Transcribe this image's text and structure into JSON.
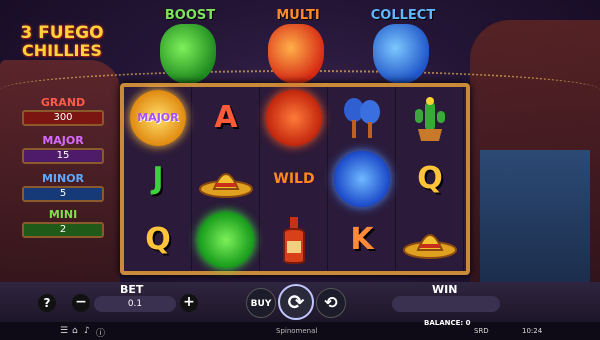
{
  "logo": {
    "line1": "3 FUEGO",
    "line2": "CHILLIES"
  },
  "features": {
    "boost": "BOOST",
    "multi": "MULTI",
    "collect": "COLLECT"
  },
  "jackpots": [
    {
      "name": "GRAND",
      "value": "300"
    },
    {
      "name": "MAJOR",
      "value": "15"
    },
    {
      "name": "MINOR",
      "value": "5"
    },
    {
      "name": "MINI",
      "value": "2"
    }
  ],
  "reels": {
    "r0": [
      "MAJOR",
      "J",
      "Q"
    ],
    "r1": [
      "A",
      "sombrero-icon",
      "orb-green"
    ],
    "r2": [
      "orb-orange",
      "WILD",
      "hot-sauce-icon"
    ],
    "r3": [
      "maracas-icon",
      "orb-blue",
      "K"
    ],
    "r4": [
      "cactus-icon",
      "Q",
      "sombrero-icon"
    ]
  },
  "controls": {
    "help": "?",
    "bet_label": "BET",
    "bet_value": "0.1",
    "minus": "−",
    "plus": "+",
    "buy": "BUY",
    "spin": "⟳",
    "autoplay": "⟲",
    "win_label": "WIN"
  },
  "status": {
    "brand": "Spinomenal",
    "balance": "BALANCE: 0",
    "currency": "SRD",
    "time": "10:24"
  }
}
